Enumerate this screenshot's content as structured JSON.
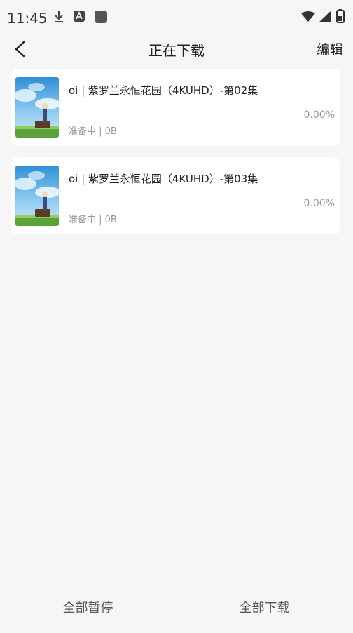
{
  "status_bar": {
    "time": "11:45",
    "icons": [
      "download-icon",
      "a-icon",
      "app-icon",
      "wifi-icon",
      "signal-icon",
      "battery-icon"
    ]
  },
  "header": {
    "title": "正在下载",
    "edit_label": "编辑",
    "back_icon": "chevron-left-icon"
  },
  "downloads": [
    {
      "title": "oi | 紫罗兰永恒花园（4KUHD）-第02集",
      "status": "准备中 | 0B",
      "progress": "0.00%"
    },
    {
      "title": "oi | 紫罗兰永恒花园（4KUHD）-第03集",
      "status": "准备中 | 0B",
      "progress": "0.00%"
    }
  ],
  "footer": {
    "pause_all_label": "全部暂停",
    "download_all_label": "全部下载"
  },
  "colors": {
    "background": "#f6f6f6",
    "card": "#ffffff",
    "muted_text": "#9a9a9a"
  }
}
